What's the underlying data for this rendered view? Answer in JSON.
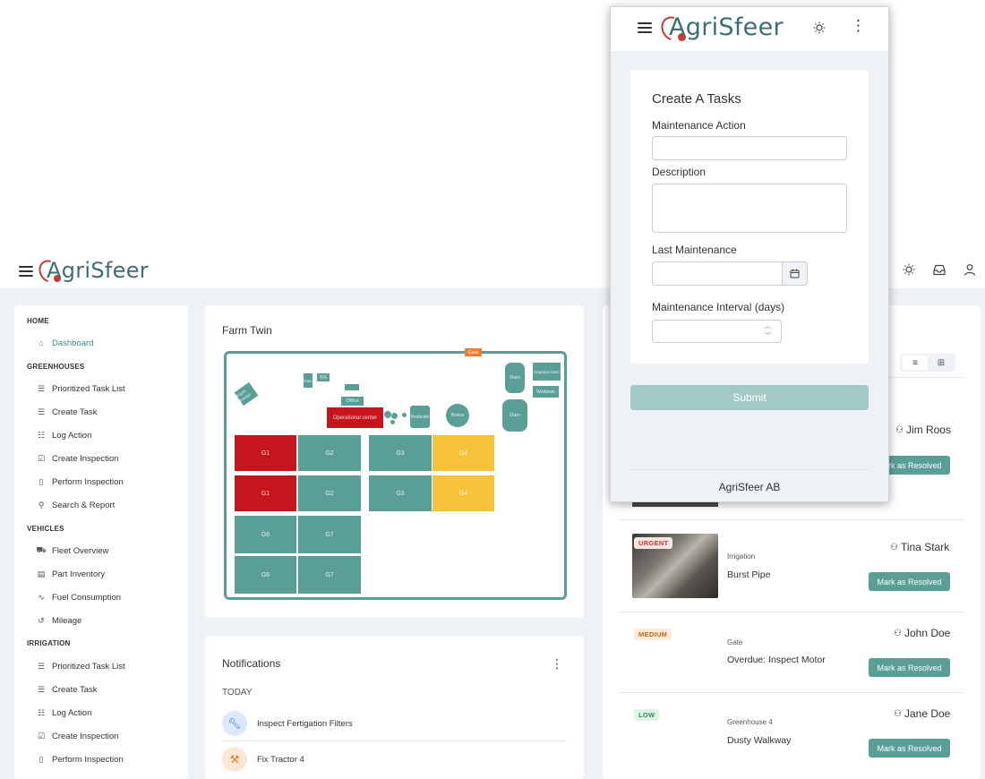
{
  "app": {
    "logo_text": "AgriSfeer"
  },
  "sidebar": {
    "home_section": "HOME",
    "dashboard": "Dashboard",
    "greenhouses_section": "GREENHOUSES",
    "greenhouses": [
      "Prioritized Task List",
      "Create Task",
      "Log Action",
      "Create Inspection",
      "Perform Inspection",
      "Search & Report"
    ],
    "vehicles_section": "VEHICLES",
    "vehicles": [
      "Fleet Overview",
      "Part Inventory",
      "Fuel Consumption",
      "Mileage"
    ],
    "irrigation_section": "IRRIGATION",
    "irrigation": [
      "Prioritized Task List",
      "Create Task",
      "Log Action",
      "Create Inspection",
      "Perform Inspection"
    ]
  },
  "farm_twin": {
    "title": "Farm Twin",
    "labels": {
      "gate": "Gate",
      "farm_house": "Farm house",
      "dam1": "Dam",
      "ws": "WS",
      "block": "",
      "office": "Office",
      "operational_center": "Operational center",
      "pesticide": "Pesticide",
      "boma": "Boma",
      "dam_right": "Dam",
      "irrigation_dam": "Irrigation Dam",
      "wetlands": "Wetlands",
      "dam_bottom": "Dam",
      "g1a": "G1",
      "g2a": "G2",
      "g3a": "G3",
      "g4a": "G4",
      "g1b": "G1",
      "g2b": "G2",
      "g3b": "G3",
      "g4b": "G4",
      "g6a": "G6",
      "g7a": "G7",
      "g6b": "G6",
      "g7b": "G7"
    }
  },
  "notifications": {
    "title": "Notifications",
    "group": "TODAY",
    "items": [
      {
        "icon": "wrench-icon",
        "text": "Inspect Fertigation Filters",
        "color": "#dce8fb"
      },
      {
        "icon": "hammer-icon",
        "text": "Fix Tractor 4",
        "color": "#fde6d2"
      }
    ]
  },
  "tasks": {
    "first_assignee": "Jim Roos",
    "resolve_label": "Mark as Resolved",
    "items": [
      {
        "priority": "URGENT",
        "category": "Irrigation",
        "title": "Burst Pipe",
        "assignee": "Tina Stark"
      },
      {
        "priority": "MEDIUM",
        "category": "Gate",
        "title": "Overdue: Inspect Motor",
        "assignee": "John Doe"
      },
      {
        "priority": "LOW",
        "category": "Greenhouse 4",
        "title": "Dusty Walkway",
        "assignee": "Jane Doe"
      }
    ]
  },
  "popup": {
    "logo_text": "AgriSfeer",
    "form_title": "Create A Tasks",
    "maintenance_action_label": "Maintenance Action",
    "maintenance_action_value": "",
    "description_label": "Description",
    "description_value": "",
    "last_maintenance_label": "Last Maintenance",
    "last_maintenance_value": "",
    "interval_label": "Maintenance Interval (days)",
    "interval_value": "",
    "submit_label": "Submit",
    "footer": "AgriSfeer AB"
  }
}
